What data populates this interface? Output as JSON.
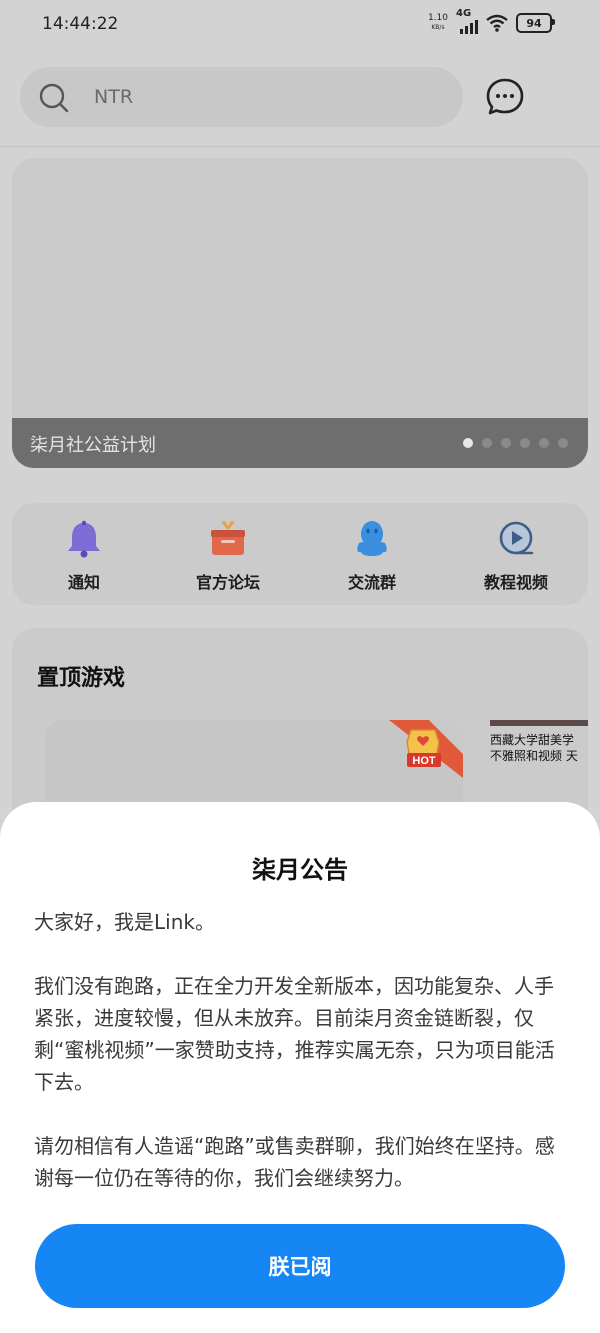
{
  "status_bar": {
    "time": "14:44:22",
    "net_speed_value": "1.10",
    "net_speed_unit": "KB/s",
    "network_type": "4G",
    "battery": "94"
  },
  "search": {
    "placeholder": "NTR",
    "icon": "search-icon"
  },
  "header": {
    "message_icon": "chat-bubble-icon"
  },
  "banner": {
    "caption": "柒月社公益计划",
    "dot_count": 6,
    "active_dot": 0
  },
  "quick_nav": {
    "items": [
      {
        "label": "通知",
        "icon": "bell-icon",
        "color": "#7d6bd6"
      },
      {
        "label": "官方论坛",
        "icon": "gift-box-icon",
        "color": "#e2684a"
      },
      {
        "label": "交流群",
        "icon": "penguin-icon",
        "color": "#3a8fe0"
      },
      {
        "label": "教程视频",
        "icon": "play-video-icon",
        "color": "#3d5f86"
      }
    ]
  },
  "pinned": {
    "title": "置顶游戏",
    "hot_badge": "HOT",
    "side_card_line1": "西藏大学甜美学",
    "side_card_line2": "不雅照和视频 天"
  },
  "modal": {
    "title": "柒月公告",
    "paragraphs": [
      "大家好，我是Link。",
      "我们没有跑路，正在全力开发全新版本，因功能复杂、人手紧张，进度较慢，但从未放弃。目前柒月资金链断裂，仅剩“蜜桃视频”一家赞助支持，推荐实属无奈，只为项目能活下去。",
      "请勿相信有人造谣“跑路”或售卖群聊，我们始终在坚持。感谢每一位仍在等待的你，我们会继续努力。"
    ],
    "confirm_label": "朕已阅"
  },
  "colors": {
    "accent": "#1686f5",
    "overlay_bg": "#d3d3d3"
  }
}
